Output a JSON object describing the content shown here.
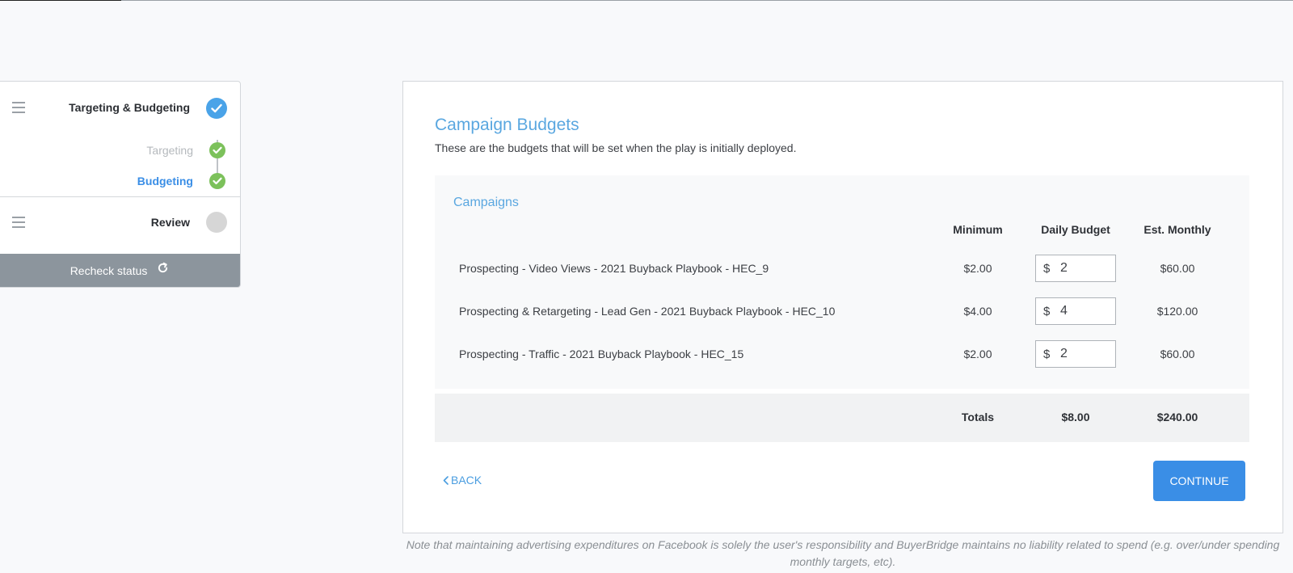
{
  "steps": {
    "main_step": "Targeting & Budgeting",
    "substeps": [
      {
        "label": "Targeting",
        "color": "#b5b9bd"
      },
      {
        "label": "Budgeting",
        "color": "#3a8ee6"
      }
    ],
    "review_step": "Review",
    "recheck_label": "Recheck status"
  },
  "card": {
    "title": "Campaign Budgets",
    "subtitle": "These are the budgets that will be set when the play is initially deployed.",
    "campaigns_title": "Campaigns",
    "columns": {
      "minimum": "Minimum",
      "daily_budget": "Daily Budget",
      "est_monthly": "Est. Monthly"
    },
    "rows": [
      {
        "name": "Prospecting - Video Views - 2021 Buyback Playbook - HEC_9",
        "minimum": "$2.00",
        "currency": "$",
        "daily_budget": "2",
        "est_monthly": "$60.00"
      },
      {
        "name": "Prospecting & Retargeting - Lead Gen - 2021 Buyback Playbook - HEC_10",
        "minimum": "$4.00",
        "currency": "$",
        "daily_budget": "4",
        "est_monthly": "$120.00"
      },
      {
        "name": "Prospecting - Traffic - 2021 Buyback Playbook - HEC_15",
        "minimum": "$2.00",
        "currency": "$",
        "daily_budget": "2",
        "est_monthly": "$60.00"
      }
    ],
    "totals": {
      "label": "Totals",
      "daily": "$8.00",
      "monthly": "$240.00"
    },
    "back_label": "BACK",
    "continue_label": "CONTINUE"
  },
  "note": "Note that maintaining advertising expenditures on Facebook is solely the user's responsibility and BuyerBridge maintains no liability related to spend (e.g. over/under spending monthly targets, etc).",
  "colors": {
    "accent": "#3a8ee6",
    "title_blue": "#5aa7e0",
    "success_green": "#7cc15b",
    "step_blue": "#4aa3e8"
  }
}
